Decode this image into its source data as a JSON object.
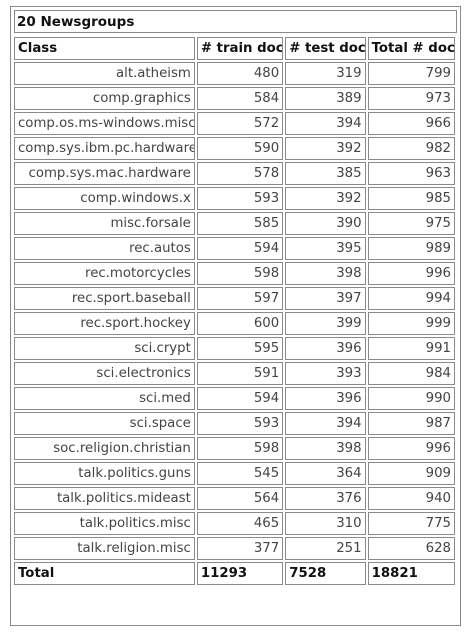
{
  "caption": "20 Newsgroups",
  "headers": [
    "Class",
    "# train docs",
    "# test docs",
    "Total # docs"
  ],
  "rows": [
    {
      "class": "alt.atheism",
      "train": "480",
      "test": "319",
      "total": "799"
    },
    {
      "class": "comp.graphics",
      "train": "584",
      "test": "389",
      "total": "973"
    },
    {
      "class": "comp.os.ms-windows.misc",
      "train": "572",
      "test": "394",
      "total": "966"
    },
    {
      "class": "comp.sys.ibm.pc.hardware",
      "train": "590",
      "test": "392",
      "total": "982"
    },
    {
      "class": "comp.sys.mac.hardware",
      "train": "578",
      "test": "385",
      "total": "963"
    },
    {
      "class": "comp.windows.x",
      "train": "593",
      "test": "392",
      "total": "985"
    },
    {
      "class": "misc.forsale",
      "train": "585",
      "test": "390",
      "total": "975"
    },
    {
      "class": "rec.autos",
      "train": "594",
      "test": "395",
      "total": "989"
    },
    {
      "class": "rec.motorcycles",
      "train": "598",
      "test": "398",
      "total": "996"
    },
    {
      "class": "rec.sport.baseball",
      "train": "597",
      "test": "397",
      "total": "994"
    },
    {
      "class": "rec.sport.hockey",
      "train": "600",
      "test": "399",
      "total": "999"
    },
    {
      "class": "sci.crypt",
      "train": "595",
      "test": "396",
      "total": "991"
    },
    {
      "class": "sci.electronics",
      "train": "591",
      "test": "393",
      "total": "984"
    },
    {
      "class": "sci.med",
      "train": "594",
      "test": "396",
      "total": "990"
    },
    {
      "class": "sci.space",
      "train": "593",
      "test": "394",
      "total": "987"
    },
    {
      "class": "soc.religion.christian",
      "train": "598",
      "test": "398",
      "total": "996"
    },
    {
      "class": "talk.politics.guns",
      "train": "545",
      "test": "364",
      "total": "909"
    },
    {
      "class": "talk.politics.mideast",
      "train": "564",
      "test": "376",
      "total": "940"
    },
    {
      "class": "talk.politics.misc",
      "train": "465",
      "test": "310",
      "total": "775"
    },
    {
      "class": "talk.religion.misc",
      "train": "377",
      "test": "251",
      "total": "628"
    }
  ],
  "total_row": {
    "label": "Total",
    "train": "11293",
    "test": "7528",
    "total": "18821"
  }
}
